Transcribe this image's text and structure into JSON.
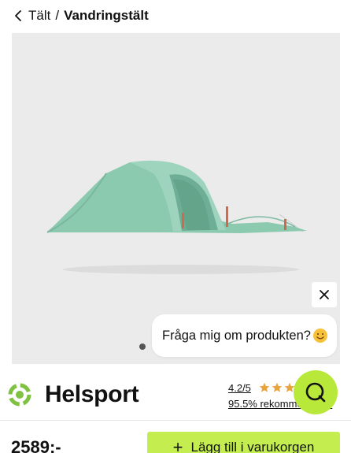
{
  "breadcrumb": {
    "parent": "Tält",
    "separator": "/",
    "current": "Vandringstält"
  },
  "gallery": {
    "image_alt": "Grönt vandringstält",
    "dot_count": 1
  },
  "chat_prompt": {
    "text": "Fråga mig om produkten?",
    "emoji": "smiling-face-icon"
  },
  "close_label": "close-icon",
  "brand": {
    "name": "Helsport"
  },
  "rating": {
    "score": "4.2/5",
    "stars": 4.2,
    "recommend_text": "95.5% rekommenderar"
  },
  "price": {
    "value": "2589:-"
  },
  "cart_button": {
    "label": "Lägg till i varukorgen"
  },
  "colors": {
    "accent": "#c4ee50",
    "fab": "#b8e93a",
    "tent": "#8ccab0",
    "star": "#e8a33d",
    "gallery_bg": "#ebebeb"
  }
}
